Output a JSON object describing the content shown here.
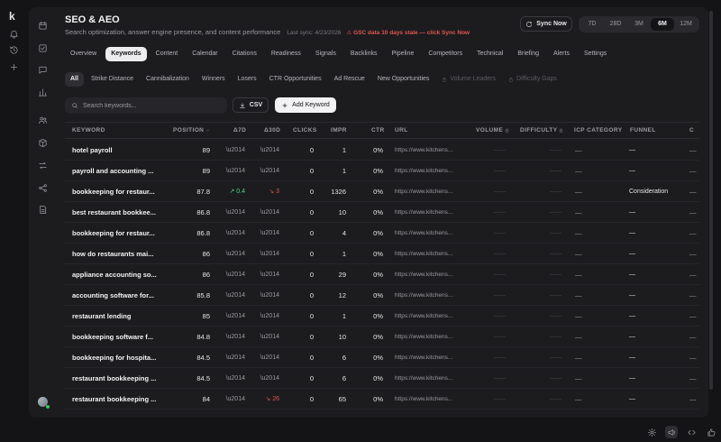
{
  "app": {
    "logo": "k"
  },
  "header": {
    "title": "SEO & AEO",
    "subtitle": "Search optimization, answer engine presence, and content performance",
    "last_sync": "Last sync: 4/23/2026",
    "warning": "⚠ GSC data 10 days stale — click Sync Now",
    "sync_label": "Sync Now"
  },
  "ranges": [
    "7D",
    "28D",
    "3M",
    "6M",
    "12M"
  ],
  "active_range": "6M",
  "tabs": [
    "Overview",
    "Keywords",
    "Content",
    "Calendar",
    "Citations",
    "Readiness",
    "Signals",
    "Backlinks",
    "Pipeline",
    "Competitors",
    "Technical",
    "Briefing",
    "Alerts",
    "Settings"
  ],
  "active_tab": "Keywords",
  "subtabs": [
    {
      "label": "All",
      "locked": false
    },
    {
      "label": "Strike Distance",
      "locked": false
    },
    {
      "label": "Cannibalization",
      "locked": false
    },
    {
      "label": "Winners",
      "locked": false
    },
    {
      "label": "Losers",
      "locked": false
    },
    {
      "label": "CTR Opportunities",
      "locked": false
    },
    {
      "label": "Ad Rescue",
      "locked": false
    },
    {
      "label": "New Opportunities",
      "locked": false
    },
    {
      "label": "Volume Leaders",
      "locked": true
    },
    {
      "label": "Difficulty Gaps",
      "locked": true
    }
  ],
  "active_subtab": "All",
  "toolbar": {
    "search_placeholder": "Search keywords...",
    "csv_label": "CSV",
    "add_label": "Add Keyword"
  },
  "columns": {
    "keyword": "KEYWORD",
    "position": "POSITION",
    "d7": "Δ7D",
    "d30": "Δ30D",
    "clicks": "CLICKS",
    "impr": "IMPR",
    "ctr": "CTR",
    "url": "URL",
    "volume": "VOLUME",
    "difficulty": "DIFFICULTY",
    "icp": "ICP CATEGORY",
    "funnel": "FUNNEL",
    "last": "C"
  },
  "rows": [
    {
      "keyword": "hotel payroll",
      "position": "89",
      "d7": "\\u2014",
      "d7_dir": "",
      "d30": "\\u2014",
      "d30_dir": "",
      "clicks": "0",
      "impr": "1",
      "ctr": "0%",
      "url": "https://www.kitchens...",
      "volume": "——",
      "difficulty": "——",
      "icp": "—",
      "funnel": "—",
      "last": "—"
    },
    {
      "keyword": "payroll and accounting ...",
      "position": "89",
      "d7": "\\u2014",
      "d7_dir": "",
      "d30": "\\u2014",
      "d30_dir": "",
      "clicks": "0",
      "impr": "1",
      "ctr": "0%",
      "url": "https://www.kitchens...",
      "volume": "——",
      "difficulty": "——",
      "icp": "—",
      "funnel": "—",
      "last": "—"
    },
    {
      "keyword": "bookkeeping for restaur...",
      "position": "87.8",
      "d7": "↗ 0.4",
      "d7_dir": "up",
      "d30": "↘ 3",
      "d30_dir": "down",
      "clicks": "0",
      "impr": "1326",
      "ctr": "0%",
      "url": "https://www.kitchens...",
      "volume": "——",
      "difficulty": "——",
      "icp": "—",
      "funnel": "Consideration",
      "last": "—"
    },
    {
      "keyword": "best restaurant bookkee...",
      "position": "86.8",
      "d7": "\\u2014",
      "d7_dir": "",
      "d30": "\\u2014",
      "d30_dir": "",
      "clicks": "0",
      "impr": "10",
      "ctr": "0%",
      "url": "https://www.kitchens...",
      "volume": "——",
      "difficulty": "——",
      "icp": "—",
      "funnel": "—",
      "last": "—"
    },
    {
      "keyword": "bookkeeping for restaur...",
      "position": "86.8",
      "d7": "\\u2014",
      "d7_dir": "",
      "d30": "\\u2014",
      "d30_dir": "",
      "clicks": "0",
      "impr": "4",
      "ctr": "0%",
      "url": "https://www.kitchens...",
      "volume": "——",
      "difficulty": "——",
      "icp": "—",
      "funnel": "—",
      "last": "—"
    },
    {
      "keyword": "how do restaurants mai...",
      "position": "86",
      "d7": "\\u2014",
      "d7_dir": "",
      "d30": "\\u2014",
      "d30_dir": "",
      "clicks": "0",
      "impr": "1",
      "ctr": "0%",
      "url": "https://www.kitchens...",
      "volume": "——",
      "difficulty": "——",
      "icp": "—",
      "funnel": "—",
      "last": "—"
    },
    {
      "keyword": "appliance accounting so...",
      "position": "86",
      "d7": "\\u2014",
      "d7_dir": "",
      "d30": "\\u2014",
      "d30_dir": "",
      "clicks": "0",
      "impr": "29",
      "ctr": "0%",
      "url": "https://www.kitchens...",
      "volume": "——",
      "difficulty": "——",
      "icp": "—",
      "funnel": "—",
      "last": "—"
    },
    {
      "keyword": "accounting software for...",
      "position": "85.8",
      "d7": "\\u2014",
      "d7_dir": "",
      "d30": "\\u2014",
      "d30_dir": "",
      "clicks": "0",
      "impr": "12",
      "ctr": "0%",
      "url": "https://www.kitchens...",
      "volume": "——",
      "difficulty": "——",
      "icp": "—",
      "funnel": "—",
      "last": "—"
    },
    {
      "keyword": "restaurant lending",
      "position": "85",
      "d7": "\\u2014",
      "d7_dir": "",
      "d30": "\\u2014",
      "d30_dir": "",
      "clicks": "0",
      "impr": "1",
      "ctr": "0%",
      "url": "https://www.kitchens...",
      "volume": "——",
      "difficulty": "——",
      "icp": "—",
      "funnel": "—",
      "last": "—"
    },
    {
      "keyword": "bookkeeping software f...",
      "position": "84.8",
      "d7": "\\u2014",
      "d7_dir": "",
      "d30": "\\u2014",
      "d30_dir": "",
      "clicks": "0",
      "impr": "10",
      "ctr": "0%",
      "url": "https://www.kitchens...",
      "volume": "——",
      "difficulty": "——",
      "icp": "—",
      "funnel": "—",
      "last": "—"
    },
    {
      "keyword": "bookkeeping for hospita...",
      "position": "84.5",
      "d7": "\\u2014",
      "d7_dir": "",
      "d30": "\\u2014",
      "d30_dir": "",
      "clicks": "0",
      "impr": "6",
      "ctr": "0%",
      "url": "https://www.kitchens...",
      "volume": "——",
      "difficulty": "——",
      "icp": "—",
      "funnel": "—",
      "last": "—"
    },
    {
      "keyword": "restaurant bookkeeping ...",
      "position": "84.5",
      "d7": "\\u2014",
      "d7_dir": "",
      "d30": "\\u2014",
      "d30_dir": "",
      "clicks": "0",
      "impr": "6",
      "ctr": "0%",
      "url": "https://www.kitchens...",
      "volume": "——",
      "difficulty": "——",
      "icp": "—",
      "funnel": "—",
      "last": "—"
    },
    {
      "keyword": "restaurant bookkeeping ...",
      "position": "84",
      "d7": "\\u2014",
      "d7_dir": "",
      "d30": "↘ 26",
      "d30_dir": "down",
      "clicks": "0",
      "impr": "65",
      "ctr": "0%",
      "url": "https://www.kitchens...",
      "volume": "——",
      "difficulty": "——",
      "icp": "—",
      "funnel": "—",
      "last": "—"
    },
    {
      "keyword": "",
      "position": "",
      "d7": "",
      "d7_dir": "",
      "d30": "",
      "d30_dir": "",
      "clicks": "",
      "impr": "",
      "ctr": "",
      "url": "",
      "volume": "",
      "difficulty": "",
      "icp": "",
      "funnel": "",
      "last": ""
    }
  ],
  "colors": {
    "bg": "#141416",
    "panel": "#1c1c1f",
    "up": "#4cd38a",
    "down": "#e0564e",
    "warning": "#e0564e"
  },
  "icons": {
    "rail": [
      "bell-icon",
      "history-icon",
      "plus-icon"
    ],
    "sidebar": [
      "calendar-icon",
      "check-square-icon",
      "chat-icon",
      "bar-chart-icon",
      "users-icon",
      "box-icon",
      "transfer-icon",
      "share-icon",
      "document-icon"
    ],
    "footer": [
      "settings-icon",
      "megaphone-icon",
      "code-icon",
      "thumbs-up-icon"
    ]
  }
}
